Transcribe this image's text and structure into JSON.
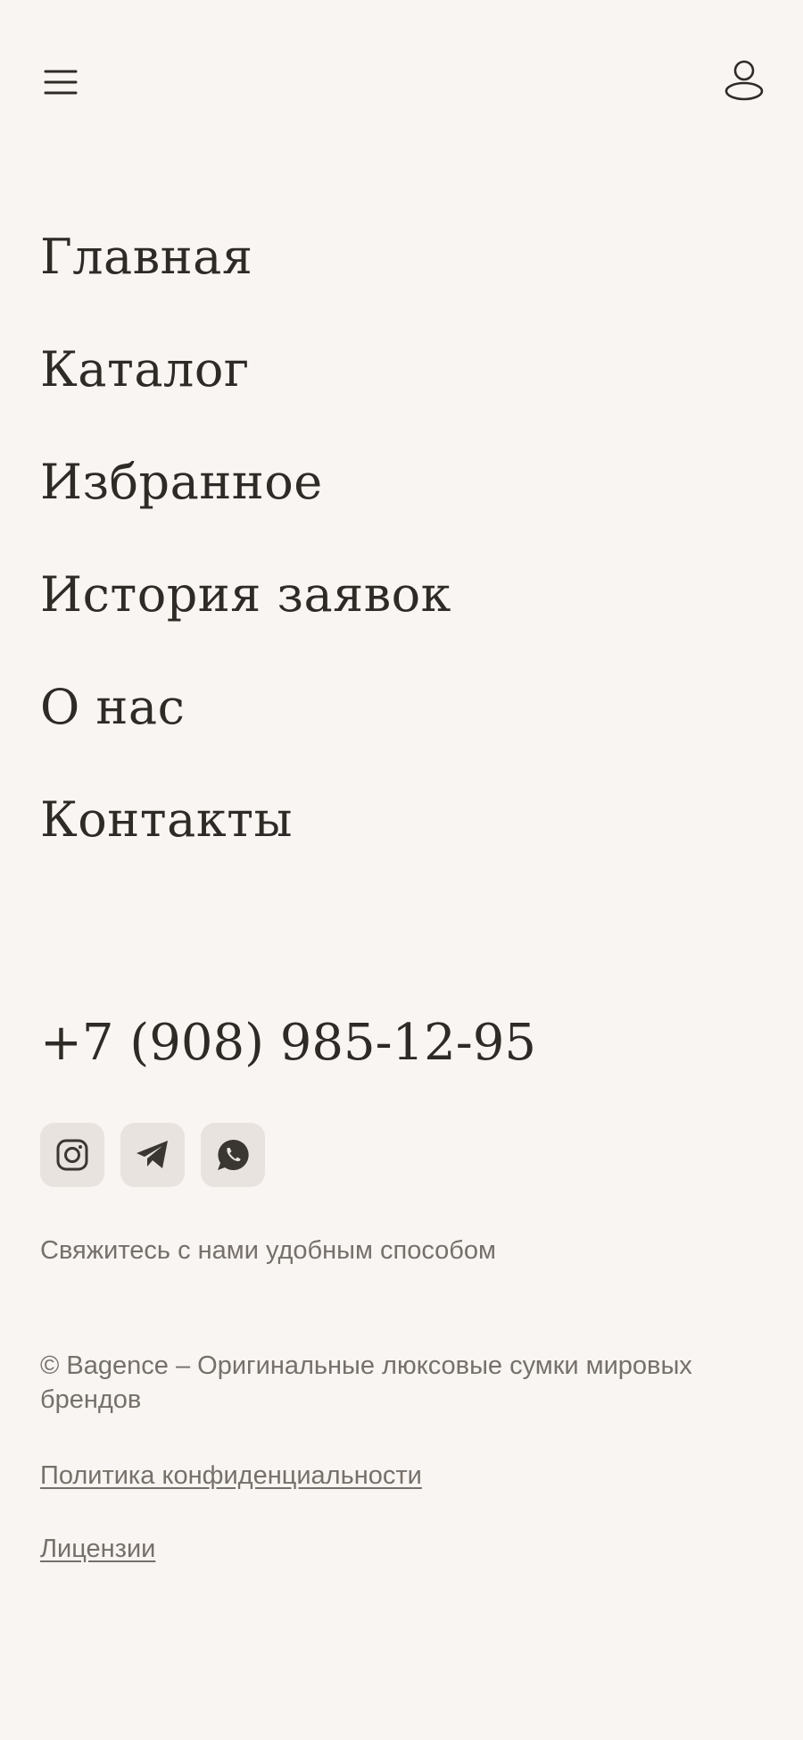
{
  "header": {
    "menu_icon": "hamburger-menu-icon",
    "profile_icon": "user-profile-icon"
  },
  "nav": {
    "items": [
      {
        "label": "Главная"
      },
      {
        "label": "Каталог"
      },
      {
        "label": "Избранное"
      },
      {
        "label": "История заявок"
      },
      {
        "label": "О нас"
      },
      {
        "label": "Контакты"
      }
    ]
  },
  "contacts": {
    "phone": "+7 (908) 985-12-95",
    "socials": [
      {
        "icon": "instagram-icon"
      },
      {
        "icon": "telegram-icon"
      },
      {
        "icon": "whatsapp-icon"
      }
    ],
    "note": "Свяжитесь с нами удобным способом"
  },
  "footer": {
    "copyright": "© Bagence – Оригинальные люксовые сумки мировых брендов",
    "privacy_label": "Политика конфиденциальности",
    "licenses_label": "Лицензии"
  },
  "colors": {
    "background": "#f9f5f2",
    "text_primary": "#2e2a26",
    "text_muted": "#76706b",
    "social_button_bg": "#e8e3df"
  }
}
